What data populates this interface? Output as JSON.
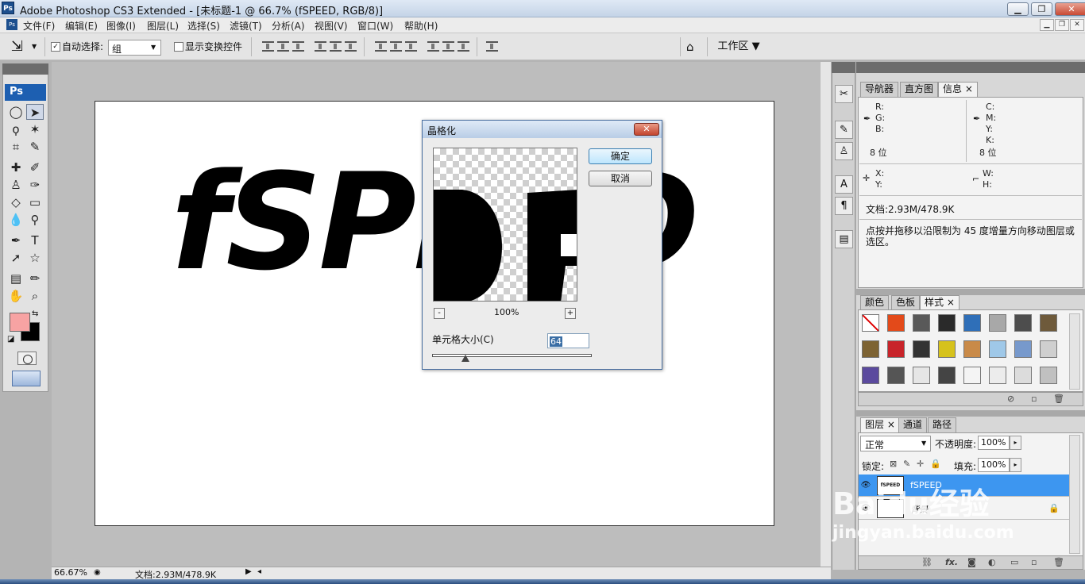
{
  "window": {
    "title": "Adobe Photoshop CS3 Extended - [未标题-1 @ 66.7% (fSPEED, RGB/8)]",
    "logo": "Ps",
    "controls": {
      "minimize": "▁",
      "maximize": "❐",
      "close": "✕"
    }
  },
  "menu": [
    "文件(F)",
    "编辑(E)",
    "图像(I)",
    "图层(L)",
    "选择(S)",
    "滤镜(T)",
    "分析(A)",
    "视图(V)",
    "窗口(W)",
    "帮助(H)"
  ],
  "options": {
    "auto_select_label": "自动选择:",
    "auto_select_value": "组",
    "show_transform_label": "显示变换控件",
    "workspace_label": "工作区"
  },
  "toolbox": {
    "badge": "Ps"
  },
  "canvas": {
    "text": "fSPEED"
  },
  "status": {
    "zoom": "66.67%",
    "doc": "文档:2.93M/478.9K"
  },
  "dialog": {
    "title": "晶格化",
    "ok_label": "确定",
    "cancel_label": "取消",
    "zoom_value": "100%",
    "zoom_minus": "-",
    "zoom_plus": "+",
    "cell_size_label": "单元格大小(C)",
    "cell_size_value": "64"
  },
  "info_panel": {
    "tabs": [
      "导航器",
      "直方图",
      "信息"
    ],
    "rgb_labels": [
      "R:",
      "G:",
      "B:"
    ],
    "cmyk_labels": [
      "C:",
      "M:",
      "Y:",
      "K:"
    ],
    "bit_left": "8 位",
    "bit_right": "8 位",
    "xy_labels": [
      "X:",
      "Y:"
    ],
    "wh_labels": [
      "W:",
      "H:"
    ],
    "doc_size": "文档:2.93M/478.9K",
    "hint": "点按并拖移以沿限制为 45 度增量方向移动图层或选区。"
  },
  "styles_panel": {
    "tabs": [
      "颜色",
      "色板",
      "样式"
    ],
    "swatches": [
      "#ffffff",
      "#e34a1a",
      "#595959",
      "#2a2a2a",
      "#2f6fb8",
      "#a8a8a8",
      "#4d4d4d",
      "#6e5a3b",
      "#7d6333",
      "#c8242a",
      "#333333",
      "#d6c21c",
      "#c98a48",
      "#9fc8e8",
      "#7799cc",
      "#cfcfcf",
      "#5b4a9e",
      "#555555",
      "#e6e6e6",
      "#444444",
      "#f4f4f4",
      "#ececec",
      "#dcdcdc",
      "#c0c0c0"
    ]
  },
  "layers_panel": {
    "tabs": [
      "图层",
      "通道",
      "路径"
    ],
    "blend_mode": "正常",
    "opacity_label": "不透明度:",
    "opacity_value": "100%",
    "lock_label": "锁定:",
    "fill_label": "填充:",
    "fill_value": "100%",
    "layers": [
      {
        "name": "fSPEED",
        "thumb": "fSPEED",
        "selected": true
      },
      {
        "name": "背景",
        "thumb": "",
        "selected": false
      }
    ]
  },
  "watermark": {
    "brand": "Baidu经验",
    "url": "jingyan.baidu.com"
  }
}
